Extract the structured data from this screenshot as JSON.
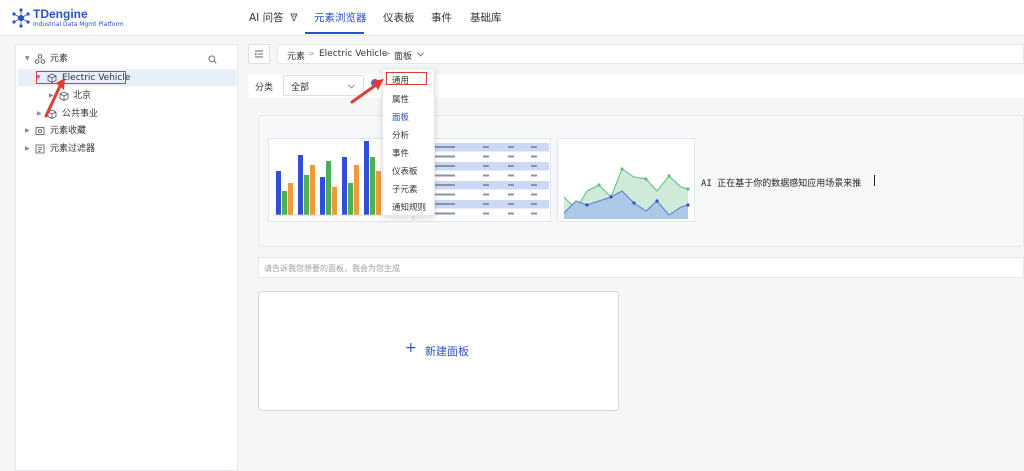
{
  "app": {
    "logo_title": "TDengine",
    "logo_subtitle": "Industrial Data Mgmt Platform",
    "brand_color": "#2b52c9"
  },
  "nav": {
    "tabs": [
      {
        "label": "AI 问答",
        "icon": "sparkle-icon"
      },
      {
        "label": "元素浏览器",
        "active": true
      },
      {
        "label": "仪表板"
      },
      {
        "label": "事件"
      },
      {
        "label": "基础库"
      }
    ]
  },
  "tree": {
    "root": {
      "label": "元素",
      "icon": "cluster-icon",
      "expanded": true
    },
    "items": [
      {
        "label": "Electric Vehicle",
        "icon": "cube-icon",
        "expanded": true,
        "selected": true
      },
      {
        "label": "北京",
        "icon": "cube-icon"
      },
      {
        "label": "公共事业",
        "icon": "cube-icon"
      },
      {
        "label": "元素收藏",
        "icon": "favorites-icon"
      },
      {
        "label": "元素过滤器",
        "icon": "filter-list-icon"
      }
    ]
  },
  "breadcrumb": {
    "items": [
      "元素",
      "Electric Vehicle",
      "面板"
    ]
  },
  "filter": {
    "label": "分类",
    "value": "全部"
  },
  "dropdown": {
    "items": [
      "通用",
      "属性",
      "面板",
      "分析",
      "事件",
      "仪表板",
      "子元素",
      "通知规则"
    ],
    "active_index": 2,
    "highlighted_index": 0
  },
  "ai_status": "AI  正在基于你的数据感知应用场景来推",
  "prompt": {
    "placeholder": "请告诉我您想要的面板，我会为您生成"
  },
  "new_panel": {
    "label": "新建面板"
  },
  "colors": {
    "bar_blue": "#2f4fd6",
    "bar_green": "#4caf50",
    "bar_orange": "#ef9a3c",
    "area_green": "#8fd0a2",
    "area_blue": "#7ea7d8",
    "table_header": "#b8c7ef",
    "annotation_red": "#e03c31"
  }
}
